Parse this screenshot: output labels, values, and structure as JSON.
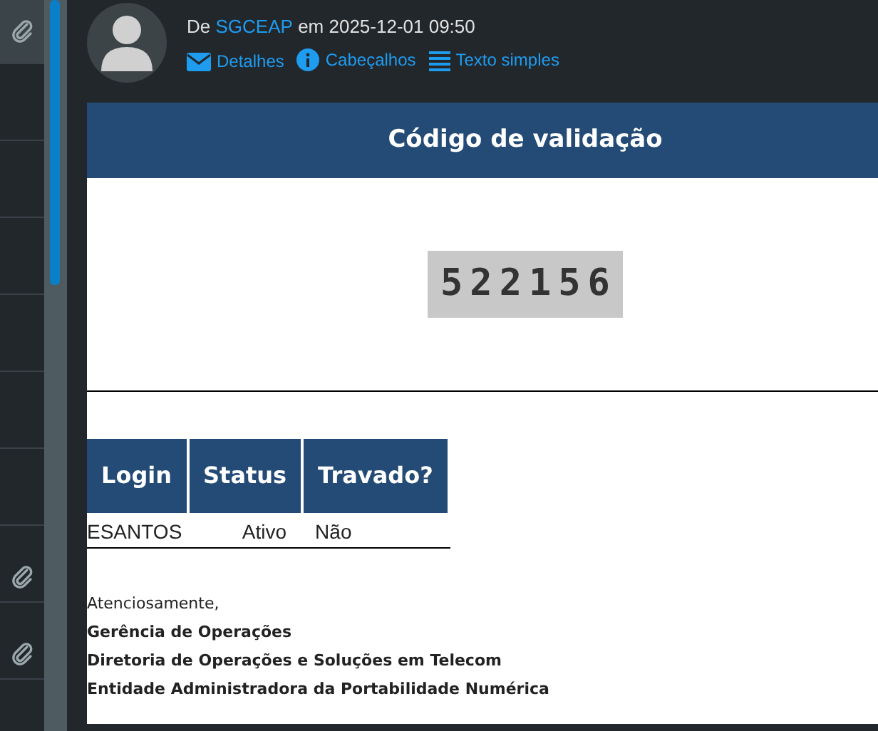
{
  "message_list": [
    {
      "attachment": true,
      "selected": true
    },
    {
      "attachment": false,
      "selected": false
    },
    {
      "attachment": false,
      "selected": false
    },
    {
      "attachment": false,
      "selected": false
    },
    {
      "attachment": false,
      "selected": false
    },
    {
      "attachment": false,
      "selected": false
    },
    {
      "attachment": false,
      "selected": false
    },
    {
      "attachment": true,
      "selected": false
    },
    {
      "attachment": true,
      "selected": false
    },
    {
      "attachment": false,
      "selected": false
    }
  ],
  "header": {
    "from_prefix": "De",
    "sender": "SGCEAP",
    "date": "em 2025-12-01 09:50",
    "links": [
      {
        "kind": "envelope",
        "label": "Detalhes"
      },
      {
        "kind": "info",
        "label": "Cabeçalhos"
      },
      {
        "kind": "lines",
        "label": "Texto simples"
      }
    ]
  },
  "email": {
    "title": "Código de validação",
    "code": "522156",
    "table": {
      "columns": [
        "Login",
        "Status",
        "Travado?"
      ],
      "rows": [
        [
          "ESANTOS",
          "Ativo",
          "Não"
        ]
      ]
    },
    "greeting": "Atenciosamente,",
    "signature": [
      "Gerência de Operações",
      "Diretoria de Operações e Soluções em Telecom",
      "Entidade Administradora da Portabilidade Numérica"
    ]
  }
}
